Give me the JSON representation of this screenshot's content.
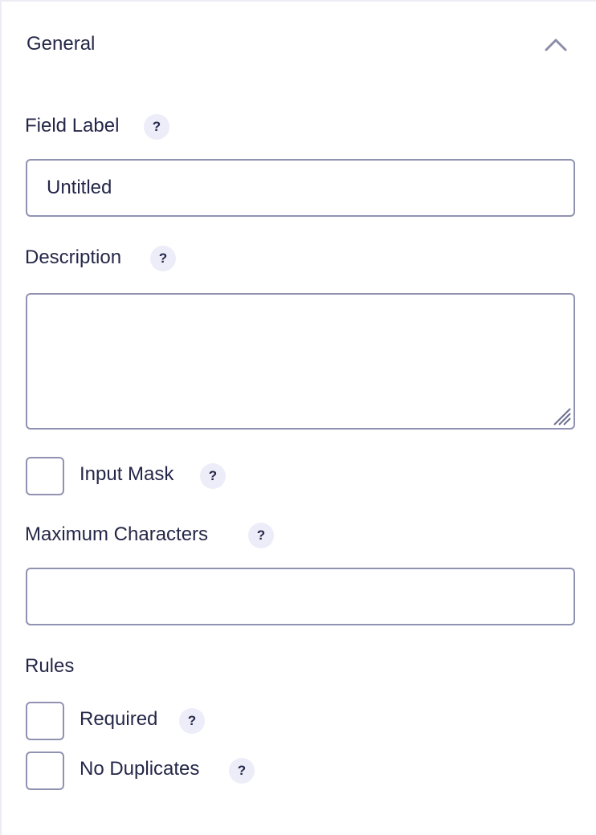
{
  "section": {
    "title": "General",
    "collapse_icon": "chevron-up-icon"
  },
  "fields": {
    "field_label": {
      "label": "Field Label",
      "value": "Untitled",
      "help": "?"
    },
    "description": {
      "label": "Description",
      "value": "",
      "help": "?"
    },
    "input_mask": {
      "label": "Input Mask",
      "checked": false,
      "help": "?"
    },
    "max_chars": {
      "label": "Maximum Characters",
      "value": "",
      "help": "?"
    }
  },
  "rules": {
    "heading": "Rules",
    "required": {
      "label": "Required",
      "checked": false,
      "help": "?"
    },
    "no_duplicates": {
      "label": "No Duplicates",
      "checked": false,
      "help": "?"
    }
  },
  "colors": {
    "text": "#242748",
    "border": "#9092b2",
    "help_bg": "#ecedf8",
    "panel_border": "#ececf4"
  }
}
